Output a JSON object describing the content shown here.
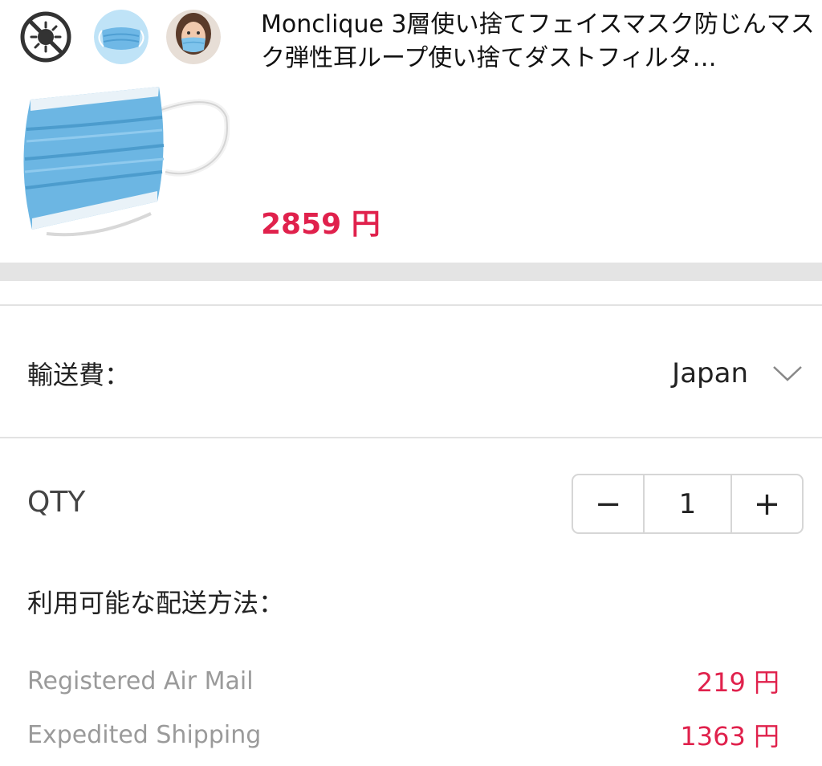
{
  "product": {
    "title": "Monclique 3層使い捨てフェイスマスク防じんマスク弾性耳ループ使い捨てダストフィルタ…",
    "price": "2859 円",
    "thumbnails": [
      "no-virus-icon",
      "mask-photo",
      "woman-mask-photo"
    ]
  },
  "shipping": {
    "label": "輸送費：",
    "country": "Japan"
  },
  "quantity": {
    "label": "QTY",
    "value": "1",
    "minus": "−",
    "plus": "+"
  },
  "delivery": {
    "label": "利用可能な配送方法：",
    "methods": [
      {
        "name": "Registered Air Mail",
        "price": "219 円"
      },
      {
        "name": "Expedited Shipping",
        "price": "1363 円"
      }
    ]
  },
  "colors": {
    "accent": "#e0214c",
    "band": "#e4e4e4",
    "mask": "#6fb8e6"
  }
}
